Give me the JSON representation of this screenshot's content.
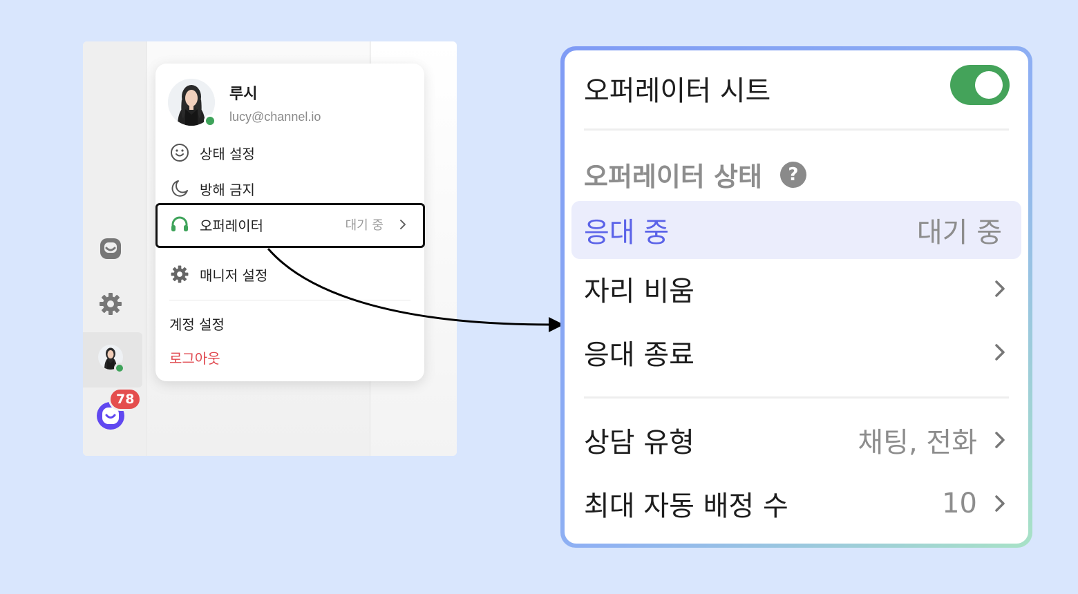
{
  "popup": {
    "profile": {
      "name": "루시",
      "email": "lucy@channel.io"
    },
    "menu": {
      "status_setting": "상태 설정",
      "do_not_disturb": "방해 금지",
      "operator": "오퍼레이터",
      "operator_status": "대기 중",
      "manager_settings": "매니저 설정",
      "account_settings": "계정 설정",
      "logout": "로그아웃"
    }
  },
  "sidebar": {
    "badge_count": "78"
  },
  "zoom_panel": {
    "title": "오퍼레이터 시트",
    "toggle_on": true,
    "section_title": "오퍼레이터 상태",
    "help_icon": "?",
    "rows": {
      "active": {
        "label": "응대 중",
        "value": "대기 중"
      },
      "away": {
        "label": "자리 비움"
      },
      "end": {
        "label": "응대 종료"
      },
      "consult_type": {
        "label": "상담 유형",
        "value": "채팅, 전화"
      },
      "max_auto_assign": {
        "label": "최대 자동 배정 수",
        "value": "10"
      }
    }
  },
  "colors": {
    "background": "#d9e6fd",
    "online": "#3ea35a",
    "toggle": "#44a35a",
    "accent": "#5b63e8",
    "logout": "#e0484f",
    "badge": "#e44e4e",
    "channel": "#6048f0"
  },
  "icons": [
    "chat-icon",
    "gear-icon",
    "smile-icon",
    "moon-icon",
    "headset-icon",
    "chevron-right-icon",
    "help-icon",
    "channel-talk-icon"
  ]
}
